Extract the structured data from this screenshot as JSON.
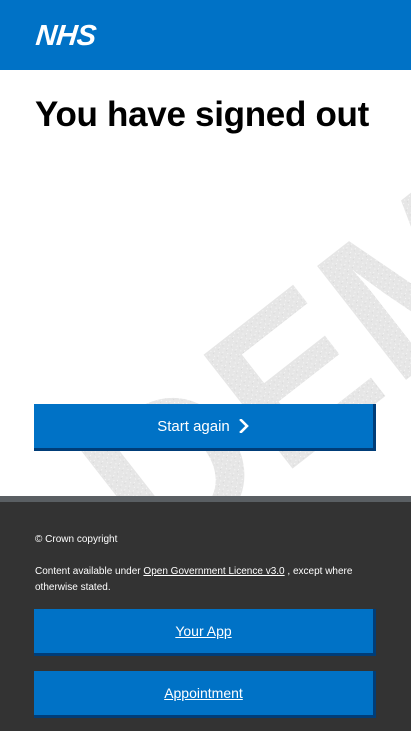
{
  "header": {
    "logo_text": "NHS",
    "background": "#0072c6"
  },
  "main": {
    "title": "You have signed out",
    "watermark_text": "DEMO",
    "start_button": {
      "label": "Start again",
      "icon": "chevron-right-icon"
    }
  },
  "footer": {
    "copyright": "© Crown copyright",
    "licence_prefix": "Content available under ",
    "licence_link": "Open Government Licence v3.0",
    "licence_suffix": " , except where otherwise stated.",
    "buttons": [
      {
        "label": "Your App"
      },
      {
        "label": "Appointment"
      }
    ],
    "background": "#333333"
  },
  "colors": {
    "accent": "#0072c6",
    "footer": "#333333",
    "divider": "#5a5f63"
  }
}
